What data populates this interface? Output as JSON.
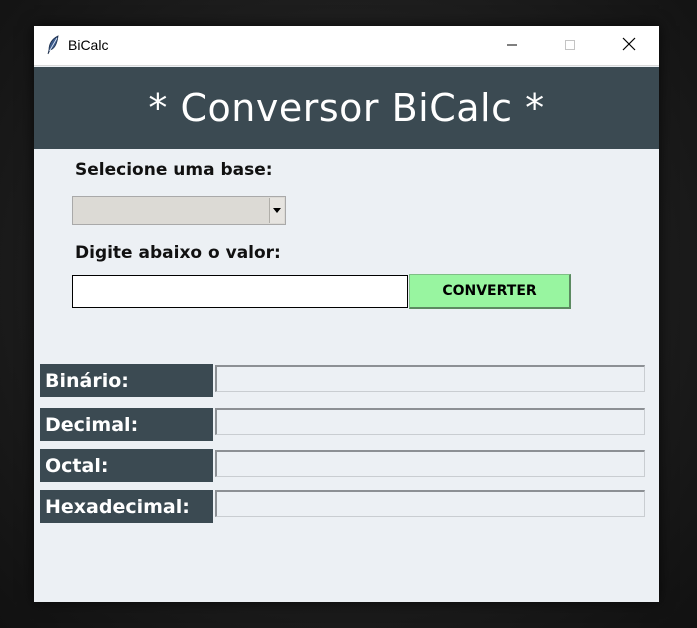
{
  "window": {
    "title": "BiCalc",
    "icon": "feather-icon",
    "controls": [
      "minimize-icon",
      "maximize-icon",
      "close-icon"
    ]
  },
  "header": {
    "title": "* Conversor BiCalc *"
  },
  "form": {
    "base_label": "Selecione uma base:",
    "base_selected": "",
    "value_label": "Digite abaixo o valor:",
    "value_input": "",
    "convert_button": "CONVERTER"
  },
  "results": {
    "binary_label": "Binário:",
    "binary_value": "",
    "decimal_label": "Decimal:",
    "decimal_value": "",
    "octal_label": "Octal:",
    "octal_value": "",
    "hex_label": "Hexadecimal:",
    "hex_value": ""
  },
  "colors": {
    "header_bg": "#3b4a52",
    "window_bg": "#ecf0f4",
    "convert_button_bg": "#98f5a0"
  }
}
